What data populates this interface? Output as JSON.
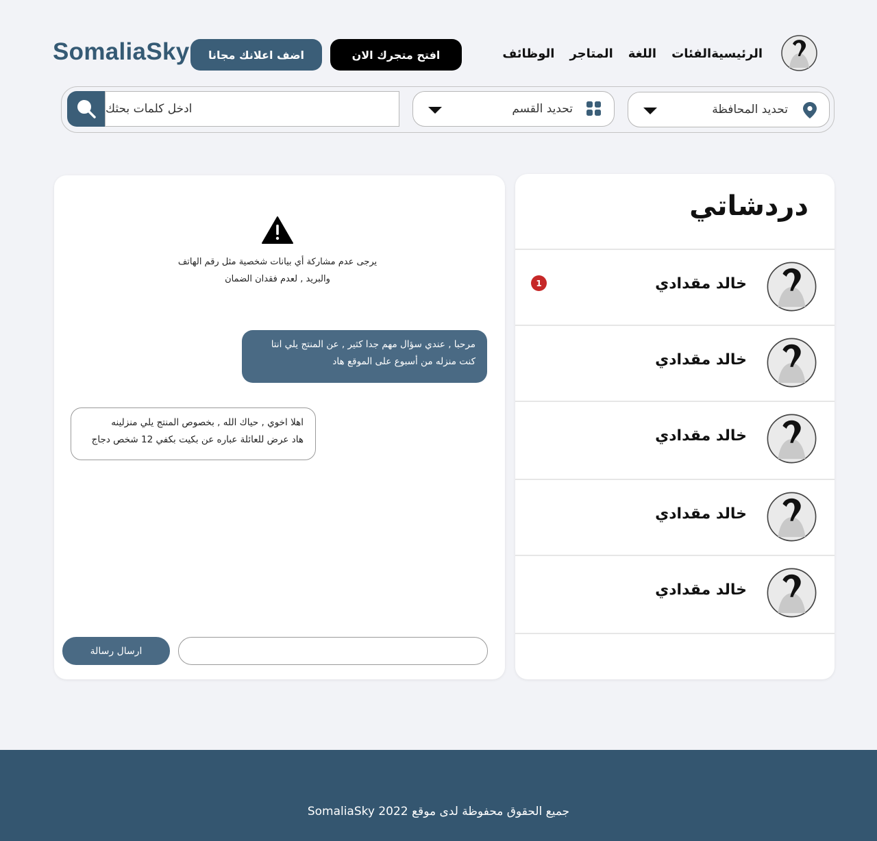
{
  "header": {
    "brand": "SomaliaSky",
    "add_ad_label": "اضف اعلانك مجانا",
    "open_store_label": "افتح متجرك الان",
    "nav": [
      "الرئيسية",
      "الفئات",
      "اللغة",
      "المتاجر",
      "الوظائف"
    ]
  },
  "search": {
    "placeholder": "ادخل كلمات بحثك",
    "category_label": "تحديد القسم",
    "governorate_label": "تحديد المحافظة"
  },
  "chat": {
    "warning_line1": "يرجى عدم مشاركة أي بيانات شخصية مثل رقم الهاتف",
    "warning_line2": "والبريد , لعدم فقدان الضمان",
    "outgoing_line1": "مرحبا , عندي سؤال مهم جدا كثير , عن المنتج يلي انتا",
    "outgoing_line2": "كنت منزله من أسبوع على الموقع هاد",
    "incoming_line1": "اهلا اخوي , حياك الله , بخصوص المنتج يلي منزلينه",
    "incoming_line2": "هاد عرض للعائلة عباره عن بكيت بكفي 12 شخص دجاج",
    "send_label": "ارسال رسالة"
  },
  "conversations": {
    "title": "دردشاتي",
    "items": [
      {
        "name": "خالد مقدادي",
        "unread": "1"
      },
      {
        "name": "خالد مقدادي",
        "unread": ""
      },
      {
        "name": "خالد مقدادي",
        "unread": ""
      },
      {
        "name": "خالد مقدادي",
        "unread": ""
      },
      {
        "name": "خالد مقدادي",
        "unread": ""
      }
    ]
  },
  "footer": {
    "copyright": "جميع الحقوق محفوظة لدى موقع SomaliaSky 2022"
  },
  "colors": {
    "primary": "#3b5e78",
    "footer": "#345670",
    "badge": "#c62828"
  }
}
